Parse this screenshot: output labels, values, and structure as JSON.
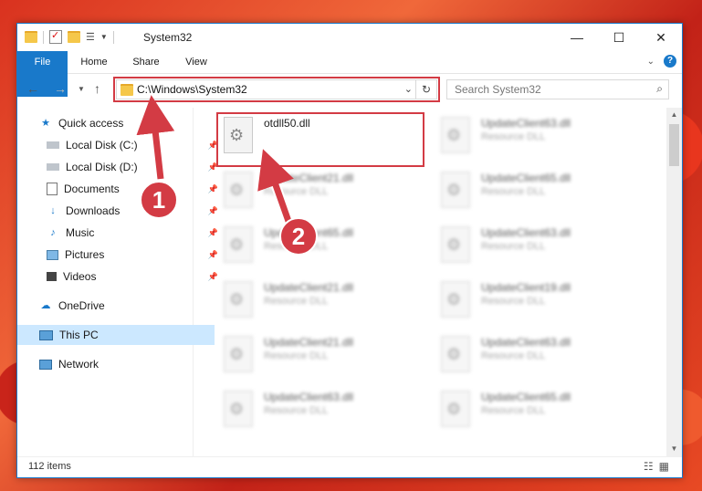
{
  "window": {
    "title": "System32"
  },
  "ribbon": {
    "tabs": [
      "File",
      "Home",
      "Share",
      "View"
    ]
  },
  "address": {
    "path": "C:\\Windows\\System32"
  },
  "search": {
    "placeholder": "Search System32"
  },
  "nav": {
    "items": [
      {
        "label": "Quick access",
        "icon": "star-icon"
      },
      {
        "label": "Local Disk (C:)",
        "icon": "drive-icon",
        "pinned": true
      },
      {
        "label": "Local Disk (D:)",
        "icon": "drive-icon",
        "pinned": true
      },
      {
        "label": "Documents",
        "icon": "documents-icon",
        "pinned": true
      },
      {
        "label": "Downloads",
        "icon": "downloads-icon",
        "pinned": true
      },
      {
        "label": "Music",
        "icon": "music-icon",
        "pinned": true
      },
      {
        "label": "Pictures",
        "icon": "pictures-icon",
        "pinned": true
      },
      {
        "label": "Videos",
        "icon": "videos-icon",
        "pinned": true
      },
      {
        "label": "OneDrive",
        "icon": "onedrive-icon"
      },
      {
        "label": "This PC",
        "icon": "computer-icon",
        "selected": true
      },
      {
        "label": "Network",
        "icon": "network-icon"
      }
    ]
  },
  "files": {
    "col1": [
      {
        "name": "otdll50.dll",
        "type": ""
      },
      {
        "name": "UpdateClient21.dll",
        "type": "Resource DLL"
      },
      {
        "name": "UpdateClient65.dll",
        "type": "Resource DLL"
      },
      {
        "name": "UpdateClient21.dll",
        "type": "Resource DLL"
      },
      {
        "name": "UpdateClient21.dll",
        "type": "Resource DLL"
      },
      {
        "name": "UpdateClient63.dll",
        "type": "Resource DLL"
      }
    ],
    "col2": [
      {
        "name": "UpdateClient63.dll",
        "type": "Resource DLL"
      },
      {
        "name": "UpdateClient65.dll",
        "type": "Resource DLL"
      },
      {
        "name": "UpdateClient63.dll",
        "type": "Resource DLL"
      },
      {
        "name": "UpdateClient19.dll",
        "type": "Resource DLL"
      },
      {
        "name": "UpdateClient63.dll",
        "type": "Resource DLL"
      },
      {
        "name": "UpdateClient65.dll",
        "type": "Resource DLL"
      }
    ]
  },
  "status": {
    "item_count": "112 items"
  },
  "annotations": {
    "step1": "1",
    "step2": "2"
  },
  "colors": {
    "accent": "#1979ca",
    "highlight": "#d33b44"
  }
}
